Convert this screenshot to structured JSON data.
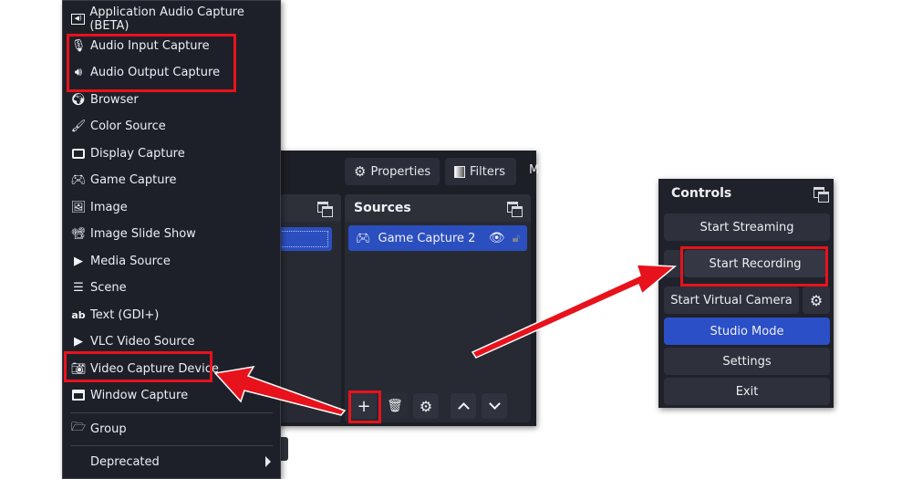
{
  "menu": {
    "items": [
      {
        "label": "Application Audio Capture (BETA)",
        "icon": "app-audio-icon"
      },
      {
        "label": "Audio Input Capture",
        "icon": "microphone-icon"
      },
      {
        "label": "Audio Output Capture",
        "icon": "speaker-icon"
      },
      {
        "label": "Browser",
        "icon": "globe-icon"
      },
      {
        "label": "Color Source",
        "icon": "brush-icon"
      },
      {
        "label": "Display Capture",
        "icon": "monitor-icon"
      },
      {
        "label": "Game Capture",
        "icon": "gamepad-icon"
      },
      {
        "label": "Image",
        "icon": "image-icon"
      },
      {
        "label": "Image Slide Show",
        "icon": "slideshow-icon"
      },
      {
        "label": "Media Source",
        "icon": "play-icon"
      },
      {
        "label": "Scene",
        "icon": "list-icon"
      },
      {
        "label": "Text (GDI+)",
        "icon": "text-icon"
      },
      {
        "label": "VLC Video Source",
        "icon": "play-icon"
      },
      {
        "label": "Video Capture Device",
        "icon": "camera-icon"
      },
      {
        "label": "Window Capture",
        "icon": "window-icon"
      }
    ],
    "group_label": "Group",
    "deprecated_label": "Deprecated"
  },
  "toolbar": {
    "properties_label": "Properties",
    "filters_label": "Filters",
    "more_label": "M"
  },
  "sources": {
    "title": "Sources",
    "items": [
      {
        "label": "Game Capture 2"
      }
    ]
  },
  "source_buttons": {
    "add": "+",
    "remove": "🗑",
    "settings": "⚙",
    "up": "︿",
    "down": "﹀"
  },
  "controls": {
    "title": "Controls",
    "start_streaming": "Start Streaming",
    "start_recording": "Start Recording",
    "start_virtual_camera": "Start Virtual Camera",
    "studio_mode": "Studio Mode",
    "settings": "Settings",
    "exit": "Exit"
  },
  "colors": {
    "accent_blue": "#2a4fc6",
    "highlight_red": "#e8121c",
    "panel_bg": "#1e2029"
  }
}
